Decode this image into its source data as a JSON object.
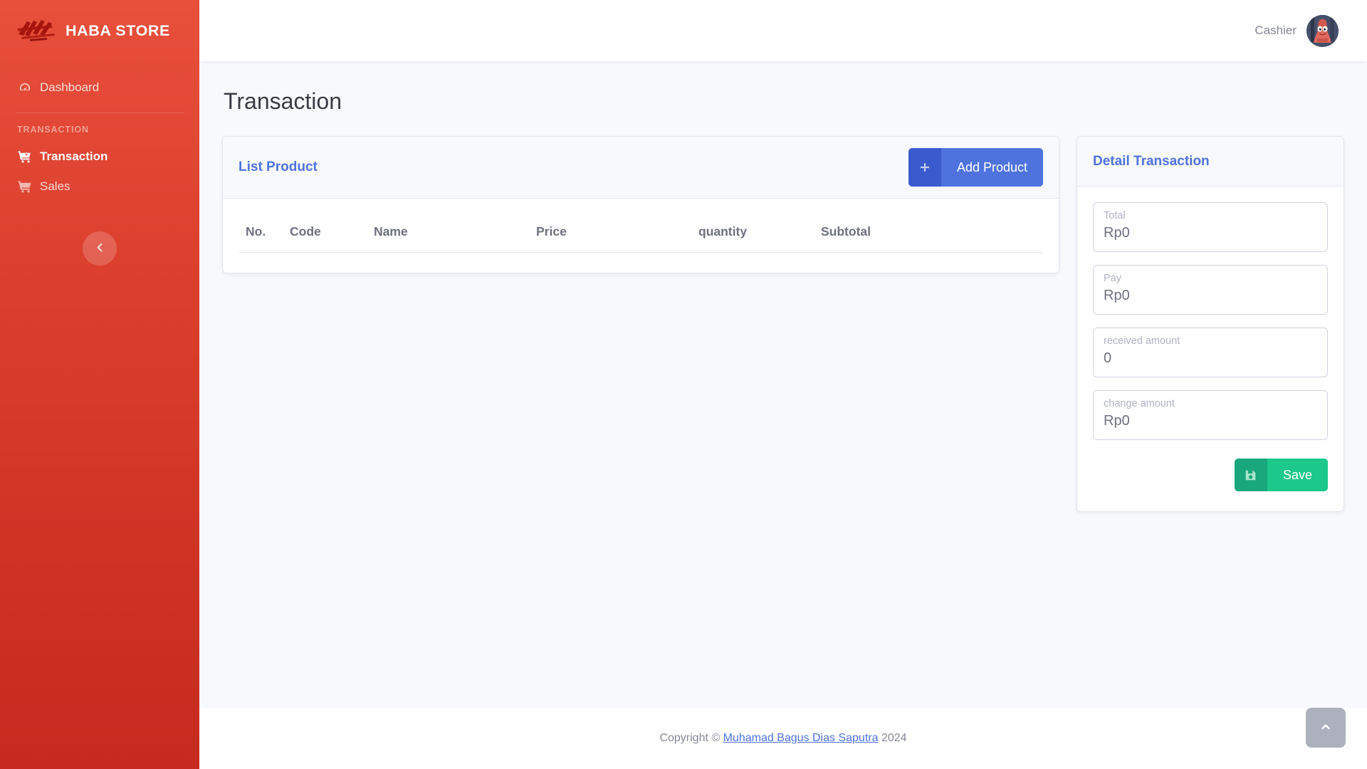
{
  "sidebar": {
    "brand": {
      "name": "HABA STORE",
      "logo_icon": "haba-graffiti-logo"
    },
    "items": [
      {
        "label": "Dashboard",
        "icon": "tachometer-icon",
        "active": false
      },
      {
        "label": "Transaction",
        "icon": "cart-plus-icon",
        "active": true
      },
      {
        "label": "Sales",
        "icon": "shopping-cart-icon",
        "active": false
      }
    ],
    "heading": "TRANSACTION",
    "collapse_icon": "chevron-left-icon"
  },
  "topbar": {
    "user_name": "Cashier",
    "avatar_icon": "user-avatar"
  },
  "page": {
    "title": "Transaction"
  },
  "list_product": {
    "title": "List Product",
    "add_button": {
      "label": "Add Product",
      "icon": "plus-icon"
    },
    "columns": [
      "No.",
      "Code",
      "Name",
      "Price",
      "quantity",
      "Subtotal"
    ],
    "rows": []
  },
  "detail": {
    "title": "Detail Transaction",
    "fields": [
      {
        "label": "Total",
        "value": "Rp0"
      },
      {
        "label": "Pay",
        "value": "Rp0"
      },
      {
        "label": "received amount",
        "value": "0"
      },
      {
        "label": "change amount",
        "value": "Rp0"
      }
    ],
    "save_button": {
      "label": "Save",
      "icon": "save-icon"
    }
  },
  "footer": {
    "prefix": "Copyright © ",
    "link": "Muhamad Bagus Dias Saputra",
    "suffix": " 2024"
  },
  "scroll_top": {
    "icon": "chevron-up-icon"
  },
  "colors": {
    "sidebar_top": "#e8503c",
    "sidebar_bottom": "#c62a1e",
    "accent_blue": "#4e73df",
    "success_green": "#1cc88a",
    "page_bg": "#f8f9fc",
    "border": "#e3e6f0"
  }
}
